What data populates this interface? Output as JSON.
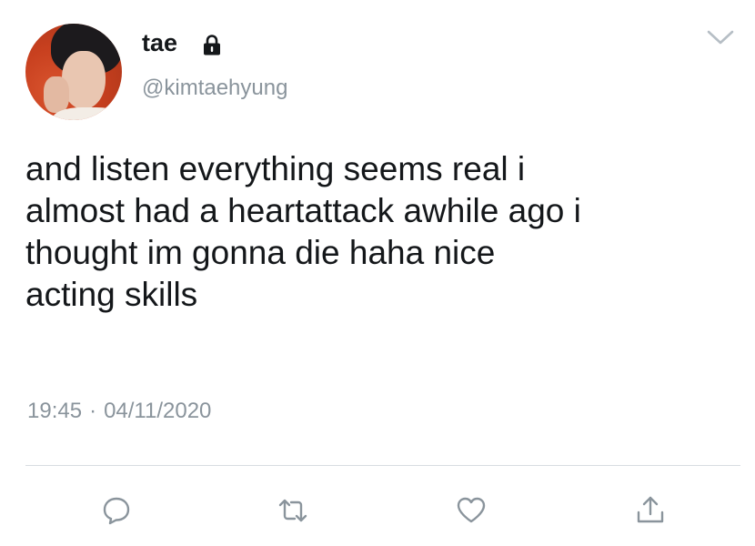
{
  "author": {
    "display_name": "tae",
    "handle": "@kimtaehyung",
    "protected_icon": "lock-icon",
    "avatar_alt": "profile photo"
  },
  "tweet": {
    "lines": [
      "and listen everything seems real i",
      "almost had a heartattack awhile ago i",
      "thought im gonna die haha nice",
      "acting skills"
    ],
    "time": "19:45",
    "separator": "·",
    "date": "04/11/2020"
  },
  "menu_icon": "chevron-down-icon",
  "actions": [
    {
      "name": "reply",
      "icon": "reply-icon"
    },
    {
      "name": "retweet",
      "icon": "retweet-icon"
    },
    {
      "name": "like",
      "icon": "heart-icon"
    },
    {
      "name": "share",
      "icon": "share-icon"
    }
  ],
  "colors": {
    "text": "#14171a",
    "secondary": "#8a949c",
    "icon": "#8a949c",
    "divider": "#d8dde1",
    "background": "#ffffff"
  }
}
